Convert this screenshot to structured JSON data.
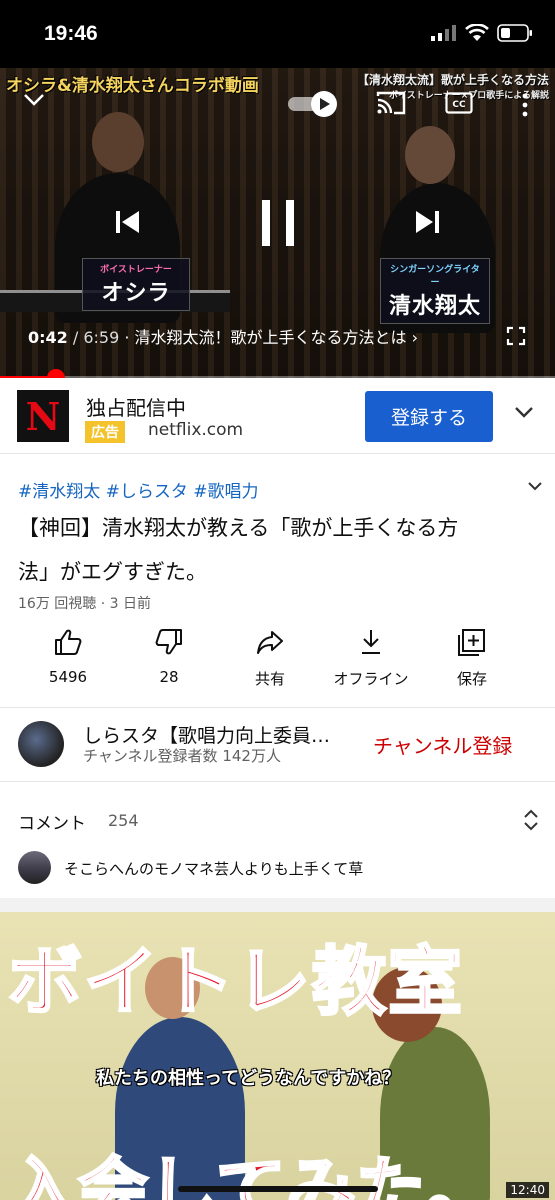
{
  "status": {
    "time": "19:46"
  },
  "player": {
    "overlay_title_left": "オシラ&清水翔太さんコラボ動画",
    "overlay_title_right": "【清水翔太流】歌が上手くなる方法",
    "overlay_title_right_sub": "ボイストレーナー×プロ歌手による解説",
    "caption_left_small": "ボイストレーナー",
    "caption_left_big": "オシラ",
    "caption_right_small": "シンガーソングライター",
    "caption_right_big": "清水翔太",
    "current_time": "0:42",
    "separator": " / ",
    "duration": "6:59",
    "chapter": " · 清水翔太流！歌が上手くなる方法とは ›",
    "progress_fraction": 0.1
  },
  "ad": {
    "logo_letter": "N",
    "title": "独占配信中",
    "badge": "広告",
    "domain": "netflix.com",
    "cta": "登録する"
  },
  "video": {
    "hashtags": "#清水翔太 #しらスタ #歌唱力",
    "title": "【神回】清水翔太が教える「歌が上手くなる方法」がエグすぎた。",
    "meta": "16万 回視聴 · 3 日前"
  },
  "actions": [
    {
      "icon": "thumb-up-icon",
      "label": "5496"
    },
    {
      "icon": "thumb-down-icon",
      "label": "28"
    },
    {
      "icon": "share-icon",
      "label": "共有"
    },
    {
      "icon": "download-icon",
      "label": "オフライン"
    },
    {
      "icon": "save-playlist-icon",
      "label": "保存"
    }
  ],
  "channel": {
    "name": "しらスタ【歌唱力向上委員…",
    "subscribers": "チャンネル登録者数 142万人",
    "subscribe_label": "チャンネル登録"
  },
  "comments": {
    "title": "コメント",
    "count": "254",
    "top_comment": "そこらへんのモノマネ芸人よりも上手くて草"
  },
  "next_video": {
    "thumb_text_top": "ボイトレ教室",
    "thumb_subtitle": "私たちの相性ってどうなんですかね？",
    "thumb_text_bottom": "入会してみた。",
    "duration": "12:40"
  }
}
